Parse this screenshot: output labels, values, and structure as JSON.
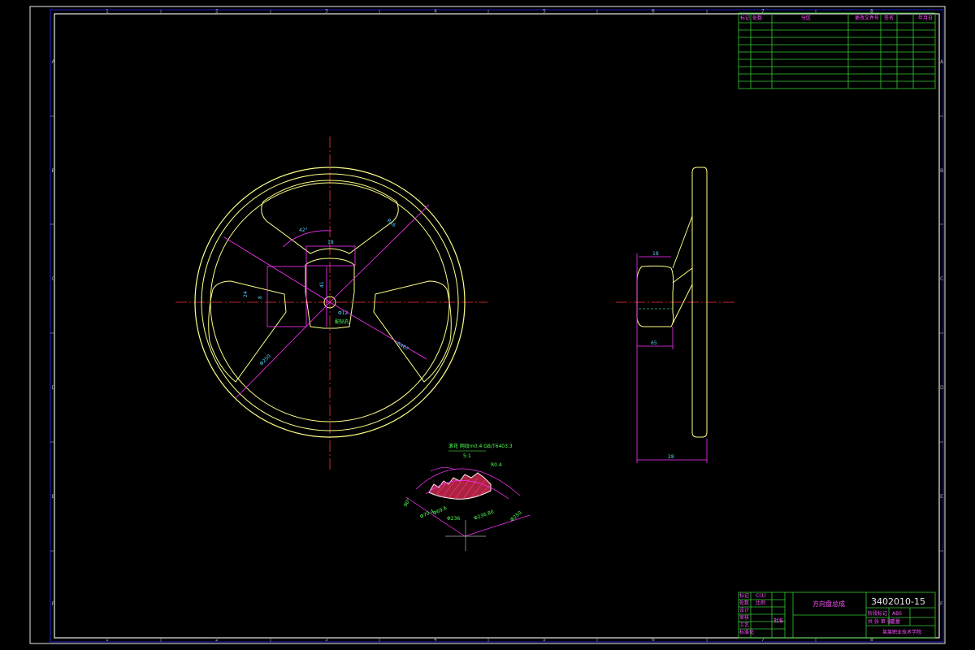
{
  "colors": {
    "background": "#000000",
    "frame": "#e8e8e8",
    "part_outline": "#ffff88",
    "dimension": "#ff33ff",
    "dimension_text": "#4fd1ff",
    "centerline": "#ff3333",
    "table_grid": "#33cc33",
    "section_hatch": "#ff3366"
  },
  "zones": {
    "columns": [
      "1",
      "2",
      "3",
      "4",
      "5",
      "6",
      "7",
      "8"
    ],
    "rows": [
      "A",
      "B",
      "C",
      "D",
      "E",
      "F"
    ]
  },
  "revision_table": {
    "headers": [
      "标记",
      "处数",
      "分区",
      "更改文件号",
      "签名",
      "年月日"
    ]
  },
  "front_view": {
    "dims": [
      "R16",
      "42°",
      "18",
      "8",
      "24",
      "41",
      "Φ12",
      "Φ250",
      "R467"
    ],
    "label": "配钻孔"
  },
  "side_view": {
    "dims": [
      "18",
      "65",
      "28"
    ]
  },
  "detail": {
    "title": "滚花  网纹m0.4 GB/T6403.3",
    "scale": "5:1",
    "dims": [
      "R0.4",
      "Φ70.4",
      "Φ69.6",
      "90°",
      "Φ236",
      "Φ236.80",
      "Φ250"
    ]
  },
  "title_block": {
    "part_no": "3402010-15",
    "name": "方向盘总成",
    "material": "ABS",
    "labels": [
      "设计",
      "审核",
      "工艺",
      "标准化",
      "批准"
    ],
    "left_labels": [
      "标记",
      "处数"
    ],
    "left_values": [
      "C(1)",
      "比例"
    ],
    "stage": "阶段标记",
    "weight": "重量",
    "sheet": "共 张 第 张",
    "school": "某某职业技术学院"
  }
}
